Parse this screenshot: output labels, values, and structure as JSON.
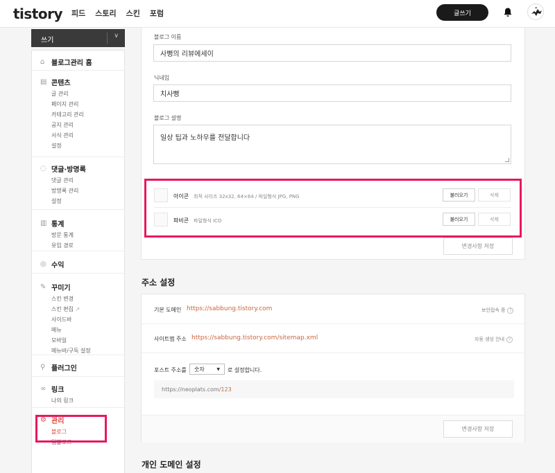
{
  "header": {
    "logo": "tistory",
    "nav": [
      "피드",
      "스토리",
      "스킨",
      "포럼"
    ],
    "write_button": "글쓰기"
  },
  "sidebar": {
    "select_label": "쓰기",
    "sections": [
      {
        "title": "블로그관리 홈",
        "icon": "home-icon",
        "items": []
      },
      {
        "title": "콘텐츠",
        "icon": "document-icon",
        "items": [
          "글 관리",
          "페이지 관리",
          "카테고리 관리",
          "공지 관리",
          "서식 관리",
          "설정"
        ]
      },
      {
        "title": "댓글·방명록",
        "icon": "comment-icon",
        "items": [
          "댓글 관리",
          "방명록 관리",
          "설정"
        ]
      },
      {
        "title": "통계",
        "icon": "bar-chart-icon",
        "items": [
          "방문 통계",
          "유입 경로"
        ]
      },
      {
        "title": "수익",
        "icon": "coin-icon",
        "items": []
      },
      {
        "title": "꾸미기",
        "icon": "brush-icon",
        "items": [
          "스킨 변경",
          "스킨 편집",
          "사이드바",
          "메뉴",
          "모바일",
          "메뉴바/구독 설정"
        ]
      },
      {
        "title": "플러그인",
        "icon": "plug-icon",
        "items": []
      },
      {
        "title": "링크",
        "icon": "link-icon",
        "items": [
          "나의 링크"
        ]
      },
      {
        "title": "관리",
        "icon": "gear-icon",
        "items": [
          "블로그",
          "팀블로그"
        ]
      }
    ]
  },
  "blog_info": {
    "name_label": "블로그 이름",
    "name_value": "사뻥의 리뷰에세이",
    "nickname_label": "닉네임",
    "nickname_value": "치사뻥",
    "desc_label": "블로그 설명",
    "desc_value": "일상 팁과 노하우를 전달합니다",
    "icon_title": "아이콘",
    "icon_desc": "최적 사이즈 32x32, 64×64 / 파일형식 JPG, PNG",
    "favicon_title": "파비콘",
    "favicon_desc": "파일형식 ICO",
    "load_label": "불러오기",
    "delete_label": "삭제",
    "save_label": "변경사항 저장"
  },
  "address": {
    "title": "주소 설정",
    "default_domain_label": "기본 도메인",
    "default_domain_value": "https://sabbung.tistory.com",
    "default_domain_hint": "보안접속 중",
    "sitemap_label": "사이트맵 주소",
    "sitemap_value": "https://sabbung.tistory.com/sitemap.xml",
    "sitemap_hint": "자동 생성 안내",
    "post_addr_prefix": "포스트 주소를",
    "post_addr_select": "숫자",
    "post_addr_suffix": "로 설정합니다.",
    "example_prefix": "https://neoplats.com/",
    "example_num": "123",
    "save_label": "변경사항 저장"
  },
  "custom_domain": {
    "title": "개인 도메인 설정"
  },
  "colors": {
    "highlight": "#e8175d",
    "accent": "#e0493a",
    "link": "#c8663e"
  }
}
